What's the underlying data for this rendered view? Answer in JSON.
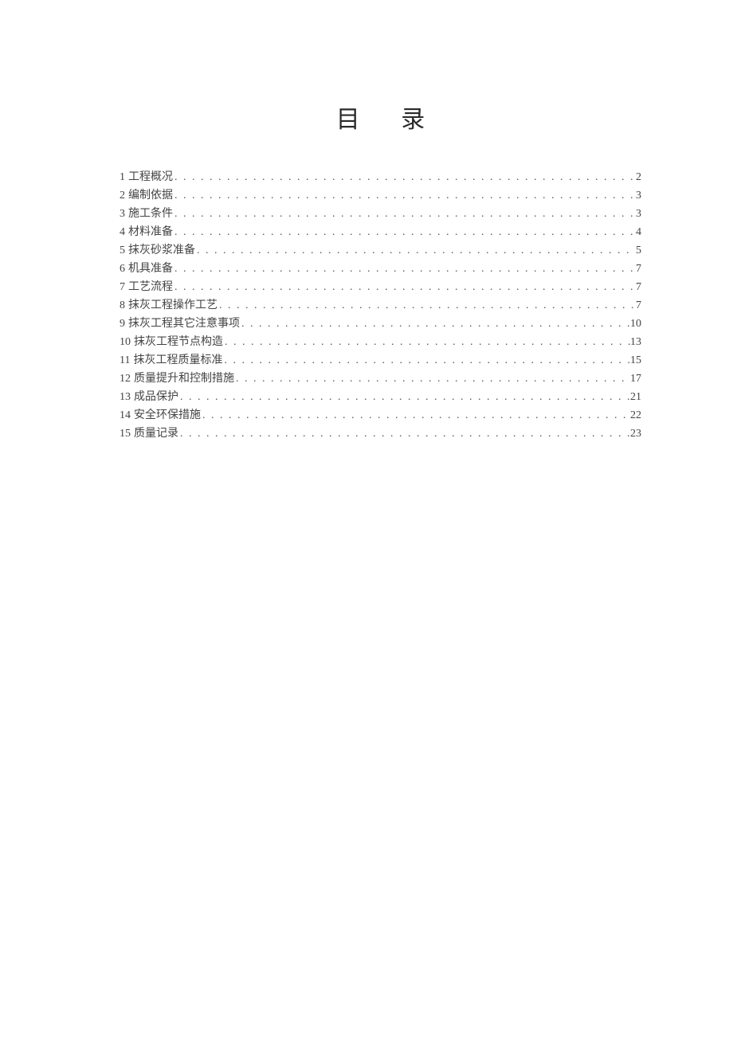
{
  "title": "目 录",
  "toc": [
    {
      "num": "1",
      "label": "工程概况",
      "page": "2"
    },
    {
      "num": "2",
      "label": "编制依据",
      "page": "3"
    },
    {
      "num": "3",
      "label": "施工条件",
      "page": "3"
    },
    {
      "num": "4",
      "label": "材料准备",
      "page": "4"
    },
    {
      "num": "5",
      "label": "抹灰砂浆准备",
      "page": "5"
    },
    {
      "num": "6",
      "label": "机具准备",
      "page": "7"
    },
    {
      "num": "7",
      "label": "工艺流程",
      "page": "7"
    },
    {
      "num": "8",
      "label": "抹灰工程操作工艺",
      "page": "7"
    },
    {
      "num": "9",
      "label": "抹灰工程其它注意事项",
      "page": "10"
    },
    {
      "num": "10",
      "label": "抹灰工程节点构造",
      "page": "13"
    },
    {
      "num": "11",
      "label": "抹灰工程质量标准",
      "page": "15"
    },
    {
      "num": "12",
      "label": "质量提升和控制措施",
      "page": "17"
    },
    {
      "num": "13",
      "label": "成品保护",
      "page": "21"
    },
    {
      "num": "14",
      "label": "安全环保措施",
      "page": "22"
    },
    {
      "num": "15",
      "label": "质量记录",
      "page": "23"
    }
  ]
}
